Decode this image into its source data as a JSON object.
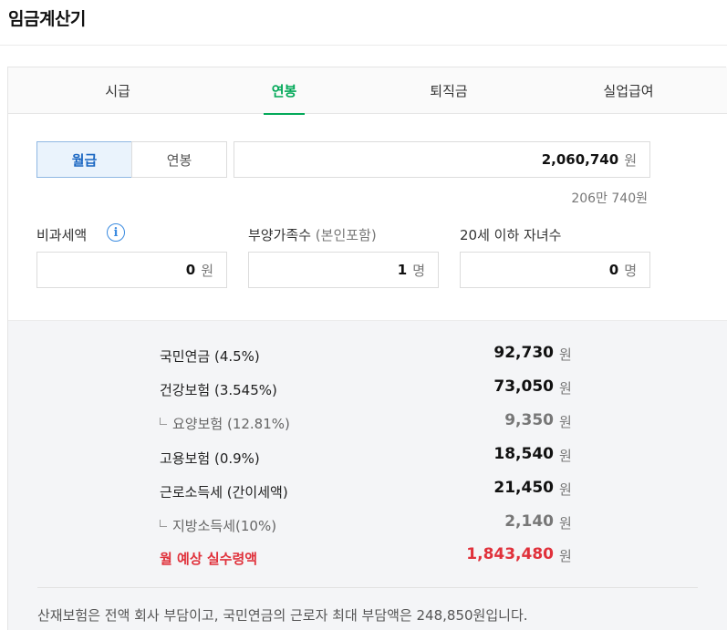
{
  "page": {
    "title": "임금계산기"
  },
  "tabs": [
    {
      "label": "시급",
      "active": false
    },
    {
      "label": "연봉",
      "active": true
    },
    {
      "label": "퇴직금",
      "active": false
    },
    {
      "label": "실업급여",
      "active": false
    }
  ],
  "salary_type": {
    "options": [
      {
        "label": "월급",
        "selected": true
      },
      {
        "label": "연봉",
        "selected": false
      }
    ]
  },
  "salary_input": {
    "value": "2,060,740",
    "unit": "원",
    "helper": "206만 740원"
  },
  "nontax": {
    "label": "비과세액",
    "value": "0",
    "unit": "원",
    "info_icon": "info-icon"
  },
  "dependents": {
    "label": "부양가족수",
    "label_sub": "(본인포함)",
    "value": "1",
    "unit": "명"
  },
  "children": {
    "label": "20세 이하 자녀수",
    "value": "0",
    "unit": "명"
  },
  "deductions": [
    {
      "label": "국민연금 (4.5%)",
      "amount": "92,730",
      "unit": "원",
      "kind": "main"
    },
    {
      "label": "건강보험 (3.545%)",
      "amount": "73,050",
      "unit": "원",
      "kind": "main"
    },
    {
      "label": "요양보험 (12.81%)",
      "amount": "9,350",
      "unit": "원",
      "kind": "sub"
    },
    {
      "label": "고용보험 (0.9%)",
      "amount": "18,540",
      "unit": "원",
      "kind": "main"
    },
    {
      "label": "근로소득세 (간이세액)",
      "amount": "21,450",
      "unit": "원",
      "kind": "main"
    },
    {
      "label": "지방소득세(10%)",
      "amount": "2,140",
      "unit": "원",
      "kind": "sub"
    },
    {
      "label": "월 예상 실수령액",
      "amount": "1,843,480",
      "unit": "원",
      "kind": "highlight"
    }
  ],
  "footnote": "산재보험은 전액 회사 부담이고, 국민연금의 근로자 최대 부담액은 248,850원입니다.",
  "colors": {
    "accent_green": "#03a959",
    "accent_blue": "#1b67c2",
    "highlight_red": "#e0313b"
  }
}
